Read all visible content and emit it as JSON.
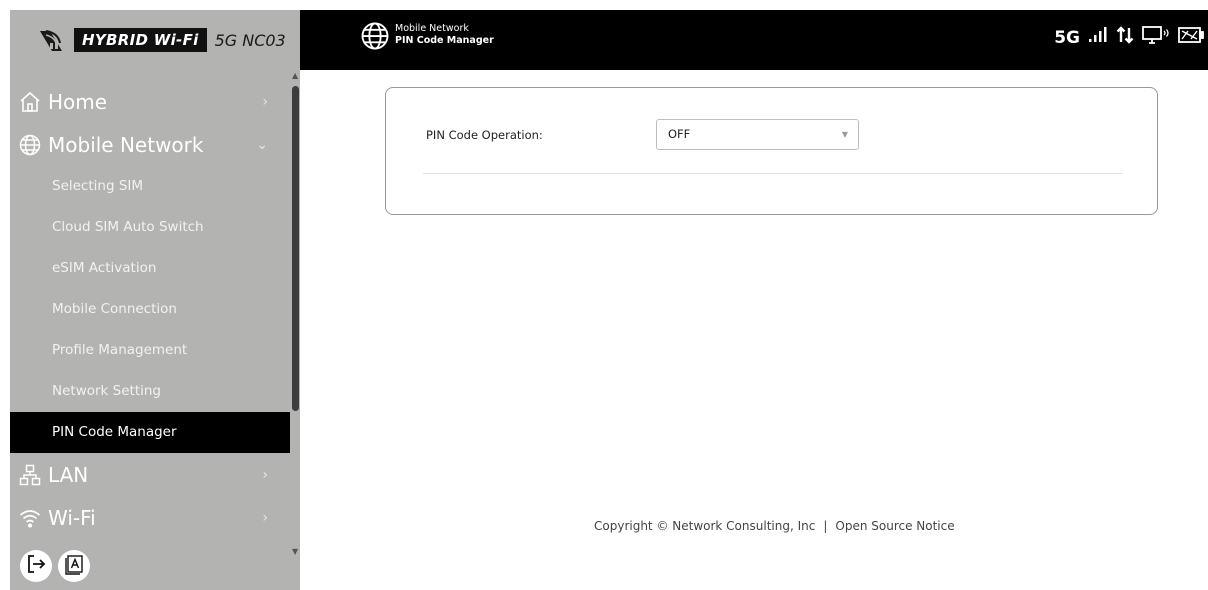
{
  "brand": {
    "hybrid_label": "HYBRID Wi-Fi",
    "model": "5G NC03"
  },
  "header": {
    "section": "Mobile Network",
    "page": "PIN Code Manager",
    "network_type": "5G",
    "icons": [
      "signal-icon",
      "data-transfer-icon",
      "connected-device-icon",
      "battery-icon"
    ]
  },
  "sidebar": {
    "home": {
      "label": "Home",
      "icon": "home-icon"
    },
    "mobile_network": {
      "label": "Mobile Network",
      "icon": "globe-icon",
      "expanded": true,
      "items": [
        {
          "label": "Selecting SIM"
        },
        {
          "label": "Cloud SIM Auto Switch"
        },
        {
          "label": "eSIM Activation"
        },
        {
          "label": "Mobile Connection"
        },
        {
          "label": "Profile Management"
        },
        {
          "label": "Network Setting"
        },
        {
          "label": "PIN Code Manager",
          "active": true
        }
      ]
    },
    "lan": {
      "label": "LAN",
      "icon": "network-icon"
    },
    "wifi": {
      "label": "Wi-Fi",
      "icon": "wifi-icon"
    },
    "bottom_icons": [
      "logout-icon",
      "font-size-icon"
    ]
  },
  "content": {
    "pin_label": "PIN Code Operation:",
    "pin_value": "OFF"
  },
  "footer": {
    "copyright": "Copyright © Network Consulting, Inc",
    "separator": "|",
    "open_source": "Open Source Notice"
  }
}
